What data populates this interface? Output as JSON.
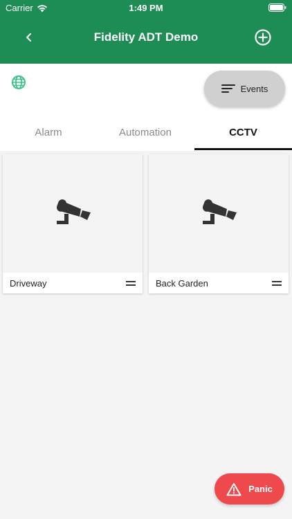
{
  "status_bar": {
    "carrier": "Carrier",
    "time": "1:49 PM"
  },
  "header": {
    "title": "Fidelity ADT Demo",
    "back_icon": "chevron-left-icon",
    "add_icon": "plus-circle-icon",
    "background_color": "#1e8c55"
  },
  "toolbar": {
    "globe_icon": "globe-icon",
    "events_label": "Events",
    "events_icon": "filter-lines-icon"
  },
  "tabs": [
    {
      "label": "Alarm",
      "active": false
    },
    {
      "label": "Automation",
      "active": false
    },
    {
      "label": "CCTV",
      "active": true
    }
  ],
  "cameras": [
    {
      "name": "Driveway",
      "icon": "cctv-camera-icon"
    },
    {
      "name": "Back Garden",
      "icon": "cctv-camera-icon"
    }
  ],
  "panic": {
    "label": "Panic",
    "icon": "warning-triangle-icon",
    "color": "#ee4a4d"
  }
}
